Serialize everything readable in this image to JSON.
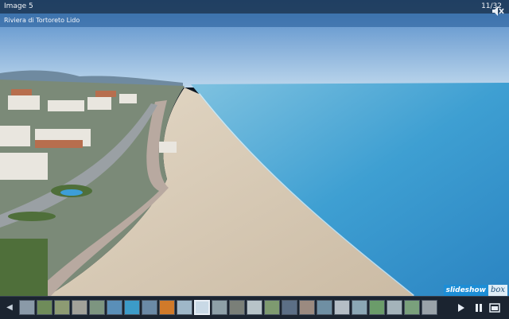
{
  "header": {
    "title": "Image 5",
    "counter": "11/32"
  },
  "caption": {
    "text": "Riviera di Tortoreto Lido"
  },
  "branding": {
    "part1": "slideshow",
    "part2": "box"
  },
  "controls": {
    "mute_icon": "speaker-mute-icon",
    "prev_icon": "chevron-left-icon",
    "play_icon": "play-icon",
    "pause_icon": "pause-icon",
    "fullscreen_icon": "fullscreen-icon"
  },
  "thumbnails": {
    "count": 24,
    "active_index": 10,
    "colors": [
      "#8a9aa8",
      "#6f8c5a",
      "#8d9b73",
      "#a2a29a",
      "#7d9580",
      "#5a8fb8",
      "#3c9bc8",
      "#6b8aa6",
      "#d07a2a",
      "#9fb7c8",
      "#c9d9e6",
      "#8ea0a8",
      "#7a7f78",
      "#b7c3c8",
      "#7e9a70",
      "#5c6f86",
      "#9b8a80",
      "#6f8fa3",
      "#b5bec6",
      "#8ba7b5",
      "#6b9c6a",
      "#a4b3ba",
      "#7aa07c",
      "#9aa3a9"
    ]
  },
  "colors": {
    "sky": "#6aa6da",
    "sea": "#3d9ed8",
    "sand": "#d8cbb8",
    "accent": "#1c8ed6"
  }
}
